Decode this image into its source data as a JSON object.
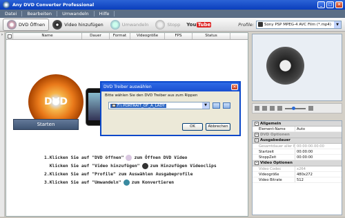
{
  "window": {
    "title": "Any DVD Converter Professional"
  },
  "menu": [
    "Datei",
    "Bearbeiten",
    "Umwandeln",
    "Hilfe"
  ],
  "toolbar": {
    "dvd_open": "DVD Öffnen",
    "add_video": "Video hinzufügen",
    "convert": "Umwandeln",
    "stop": "Stopp",
    "youtube_you": "You",
    "youtube_tube": "Tube",
    "profile_label": "Profile:",
    "profile_value": "Sony PSP MPEG-4 AVC Film (*.mp4)"
  },
  "columns": [
    "Name",
    "Dauer",
    "Format",
    "Videogröße",
    "FPS",
    "Status"
  ],
  "main": {
    "start_button": "Starten",
    "dvd_logo": "DVD",
    "steps": [
      {
        "pre": "1.Klicken Sie auf \"DVD öffnen\"",
        "post": "zum Öffnen DVD Video"
      },
      {
        "pre": "  Klicken Sie auf \"Video hinzufügen\"",
        "post": "zum Hinzufügen Videoclips"
      },
      {
        "pre": "2.Klicken Sie auf \"Profile\" zum Auswählen Ausgabeprofile",
        "post": ""
      },
      {
        "pre": "3.Klicken Sie auf \"Umwandeln\"",
        "post": "zum Konvertieren"
      }
    ]
  },
  "properties": {
    "sections": [
      {
        "title": "Allgemein",
        "dim": false,
        "rows": [
          {
            "k": "Element-Name",
            "v": "Auto",
            "grey": false
          }
        ]
      },
      {
        "title": "DVD Optionen",
        "dim": true,
        "rows": []
      },
      {
        "title": "Ausgabedauer",
        "dim": false,
        "rows": [
          {
            "k": "Gesamtdauer aller El...",
            "v": "00:00:00.00:00",
            "grey": true
          },
          {
            "k": "Startzeit",
            "v": "00:00:00",
            "grey": false
          },
          {
            "k": "StoppZeit",
            "v": "00:00:00",
            "grey": false
          }
        ]
      },
      {
        "title": "Video Optionen",
        "dim": false,
        "rows": [
          {
            "k": "Video Codec",
            "v": "x264",
            "grey": true
          },
          {
            "k": "Videogröße",
            "v": "480x272",
            "grey": false
          },
          {
            "k": "Video Bitrate",
            "v": "512",
            "grey": false
          }
        ]
      }
    ]
  },
  "dialog": {
    "title": "DVD Treiber auswählen",
    "message": "Bitte wählen Sie den DVD Treiber aus zum Rippen",
    "drive_value": "F:\\ PORTRAIT_OF_A_LADY",
    "ok": "OK",
    "cancel": "Abbrechen"
  }
}
